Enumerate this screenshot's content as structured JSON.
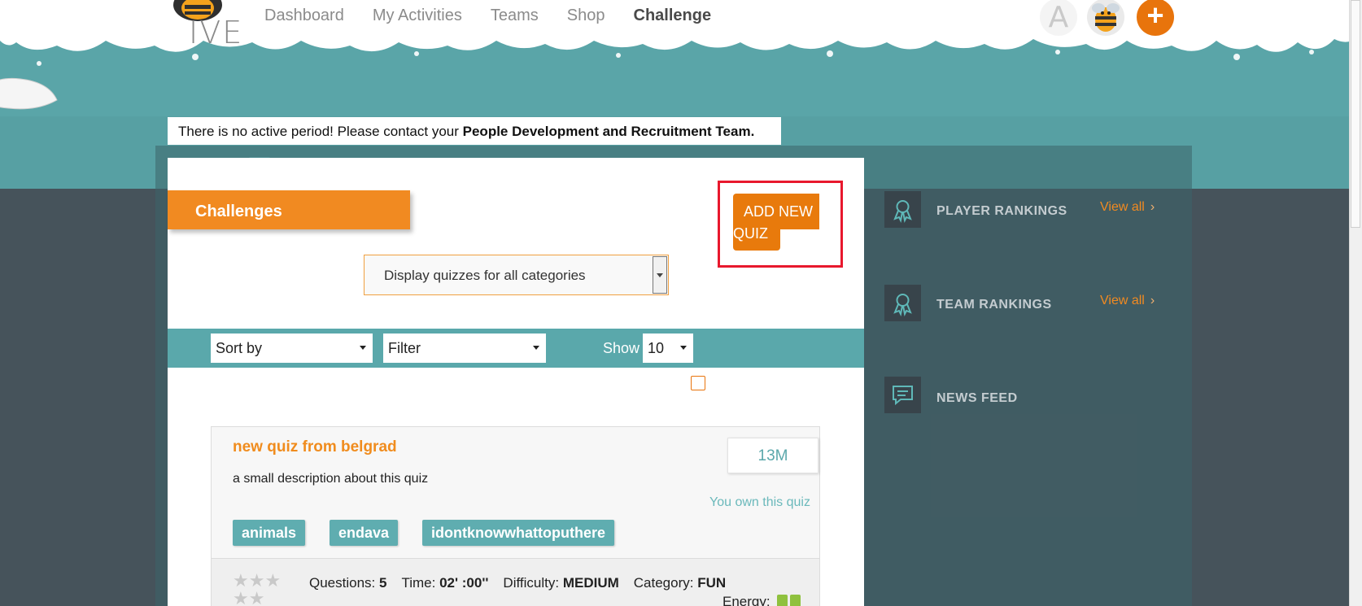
{
  "app": {
    "logo_text": "IVE"
  },
  "nav": {
    "items": [
      "Dashboard",
      "My Activities",
      "Teams",
      "Shop",
      "Challenge"
    ],
    "active": "Challenge"
  },
  "header": {
    "avatar_letter": "A",
    "plus_label": "+"
  },
  "alert": {
    "text": "There is no active period! Please contact your ",
    "bold": "People Development and Recruitment Team."
  },
  "challenges": {
    "tab_label": "Challenges",
    "add_button_line1": "ADD NEW",
    "add_button_line2": "QUIZ",
    "category_select": "Display quizzes for all categories"
  },
  "filters": {
    "sort_label": "Sort by",
    "filter_label": "Filter",
    "show_label": "Show",
    "show_value": "10"
  },
  "quiz": {
    "title": "new quiz from belgrad",
    "description": "a small description about this quiz",
    "time_badge": "13M",
    "owner_text": "You own this quiz",
    "tags": [
      "animals",
      "endava",
      "idontknowwhattoputhere"
    ],
    "rating_stars": 0,
    "questions_label": "Questions:",
    "questions_value": "5",
    "time_label": "Time:",
    "time_value": "02' :00''",
    "difficulty_label": "Difficulty:",
    "difficulty_value": "MEDIUM",
    "category_label": "Category:",
    "category_value": "FUN",
    "energy_label": "Energy:"
  },
  "sidebar": {
    "player_rankings": "PLAYER RANKINGS",
    "team_rankings": "TEAM RANKINGS",
    "news_feed": "NEWS FEED",
    "view_all": "View all",
    "chevron": "›"
  },
  "colors": {
    "accent_orange": "#f18a21",
    "teal": "#5aa8ab",
    "dark_panel": "#46535b",
    "highlight_red": "#e8182d"
  }
}
